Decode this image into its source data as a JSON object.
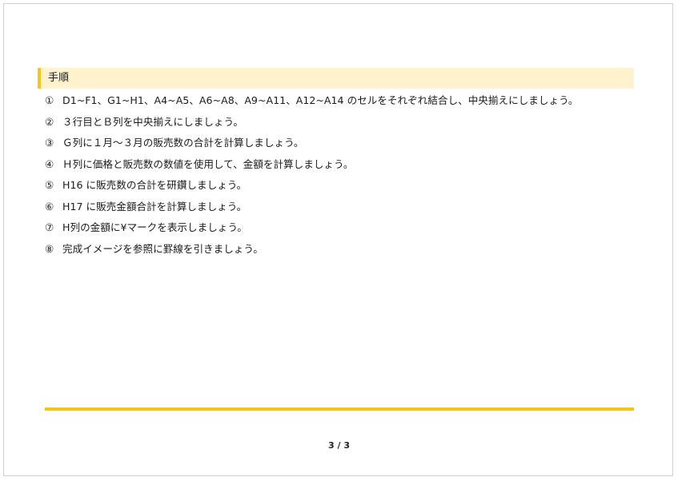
{
  "section": {
    "title": "手順"
  },
  "steps": [
    {
      "num": "①",
      "text": "D1~F1、G1~H1、A4~A5、A6~A8、A9~A11、A12~A14 のセルをそれぞれ結合し、中央揃えにしましょう。"
    },
    {
      "num": "②",
      "text": "３行目とＢ列を中央揃えにしましょう。"
    },
    {
      "num": "③",
      "text": "Ｇ列に１月～３月の販売数の合計を計算しましょう。"
    },
    {
      "num": "④",
      "text": "Ｈ列に価格と販売数の数値を使用して、金額を計算しましょう。"
    },
    {
      "num": "⑤",
      "text": "H16 に販売数の合計を研鑽しましょう。"
    },
    {
      "num": "⑥",
      "text": "H17 に販売金額合計を計算しましょう。"
    },
    {
      "num": "⑦",
      "text": "H列の金額に¥マークを表示しましょう。"
    },
    {
      "num": "⑧",
      "text": "完成イメージを参照に罫線を引きましょう。"
    }
  ],
  "footer": {
    "page_number": "3 / 3"
  },
  "colors": {
    "accent": "#f5c518",
    "header_background": "#fff2cc"
  }
}
